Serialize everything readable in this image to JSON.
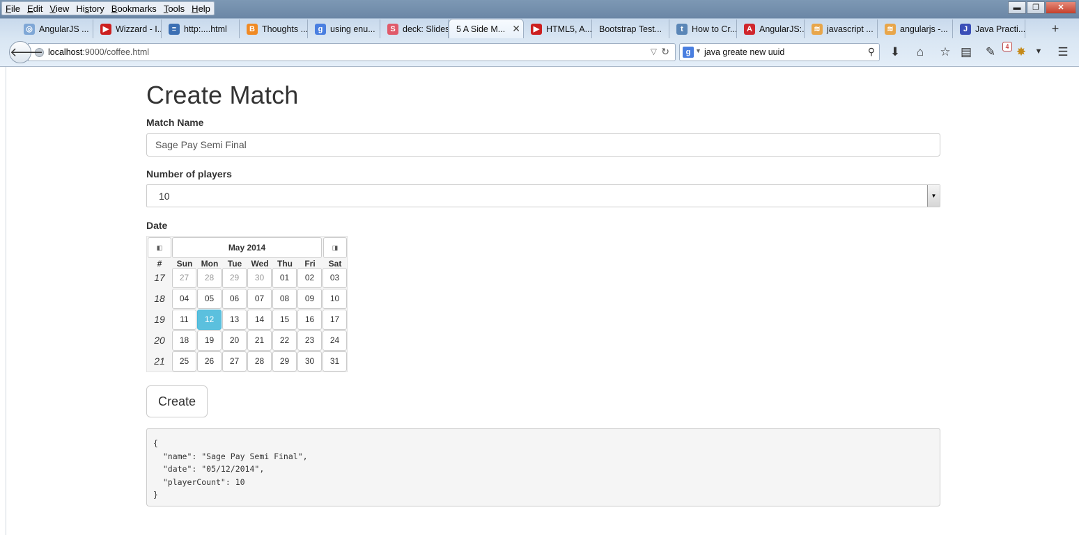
{
  "browser": {
    "menu": [
      {
        "mn": "F",
        "rest": "ile"
      },
      {
        "mn": "E",
        "rest": "dit"
      },
      {
        "mn": "V",
        "rest": "iew"
      },
      {
        "mn": "",
        "rest": "Hi",
        "mn2": "s",
        "rest2": "tory"
      },
      {
        "mn": "B",
        "rest": "ookmarks"
      },
      {
        "mn": "T",
        "rest": "ools"
      },
      {
        "mn": "H",
        "rest": "elp"
      }
    ],
    "tabs": [
      {
        "label": "AngularJS ...",
        "icon": "angularjs-icon",
        "color": "#7fa7d6",
        "glyph": "◎"
      },
      {
        "label": "Wizzard - I...",
        "icon": "youtube-icon",
        "color": "#cc1f1f",
        "glyph": "▶"
      },
      {
        "label": "http:....html",
        "icon": "page-icon",
        "color": "#3b6fb3",
        "glyph": "≡"
      },
      {
        "label": "Thoughts ...",
        "icon": "blogger-icon",
        "color": "#f08a24",
        "glyph": "B"
      },
      {
        "label": "using enu...",
        "icon": "google-icon",
        "color": "#4a7fe0",
        "glyph": "g"
      },
      {
        "label": "deck: Slides",
        "icon": "slides-icon",
        "color": "#e05a6a",
        "glyph": "S"
      },
      {
        "label": "5 A Side M...",
        "icon": "",
        "color": "",
        "glyph": "",
        "active": true
      },
      {
        "label": "HTML5, A...",
        "icon": "youtube-icon",
        "color": "#cc1f1f",
        "glyph": "▶"
      },
      {
        "label": "Bootstrap Test...",
        "icon": "",
        "color": "",
        "glyph": ""
      },
      {
        "label": "How to Cr...",
        "icon": "tumblr-icon",
        "color": "#5a86b7",
        "glyph": "t"
      },
      {
        "label": "AngularJS:...",
        "icon": "angular-shield-icon",
        "color": "#d0262d",
        "glyph": "A"
      },
      {
        "label": "javascript ...",
        "icon": "stackoverflow-icon",
        "color": "#e8a64a",
        "glyph": "≋"
      },
      {
        "label": "angularjs -...",
        "icon": "stackoverflow-icon",
        "color": "#e8a64a",
        "glyph": "≋"
      },
      {
        "label": "Java Practi...",
        "icon": "java-icon",
        "color": "#3b4fb8",
        "glyph": "J"
      }
    ],
    "new_tab": "+",
    "url_host": "localhost",
    "url_rest": ":9000/coffee.html",
    "search_query": "java greate new uuid",
    "badge_count": "4",
    "win_min": "▬",
    "win_max": "❐",
    "win_close": "✕"
  },
  "form": {
    "title": "Create Match",
    "match_name_label": "Match Name",
    "match_name_value": "Sage Pay Semi Final",
    "players_label": "Number of players",
    "players_value": "10",
    "date_label": "Date",
    "create_label": "Create"
  },
  "datepicker": {
    "month_title": "May 2014",
    "prev_icon": "calendar-prev-icon",
    "next_icon": "calendar-next-icon",
    "headers": [
      "#",
      "Sun",
      "Mon",
      "Tue",
      "Wed",
      "Thu",
      "Fri",
      "Sat"
    ],
    "weeks": [
      {
        "week": "17",
        "days": [
          "27",
          "28",
          "29",
          "30",
          "01",
          "02",
          "03"
        ],
        "muted": [
          0,
          1,
          2,
          3
        ]
      },
      {
        "week": "18",
        "days": [
          "04",
          "05",
          "06",
          "07",
          "08",
          "09",
          "10"
        ],
        "muted": []
      },
      {
        "week": "19",
        "days": [
          "11",
          "12",
          "13",
          "14",
          "15",
          "16",
          "17"
        ],
        "muted": []
      },
      {
        "week": "20",
        "days": [
          "18",
          "19",
          "20",
          "21",
          "22",
          "23",
          "24"
        ],
        "muted": []
      },
      {
        "week": "21",
        "days": [
          "25",
          "26",
          "27",
          "28",
          "29",
          "30",
          "31"
        ],
        "muted": []
      }
    ],
    "selected_day": "12",
    "selected_color": "#5bc0de"
  },
  "output": {
    "json_text": "{\n  \"name\": \"Sage Pay Semi Final\",\n  \"date\": \"05/12/2014\",\n  \"playerCount\": 10\n}"
  }
}
